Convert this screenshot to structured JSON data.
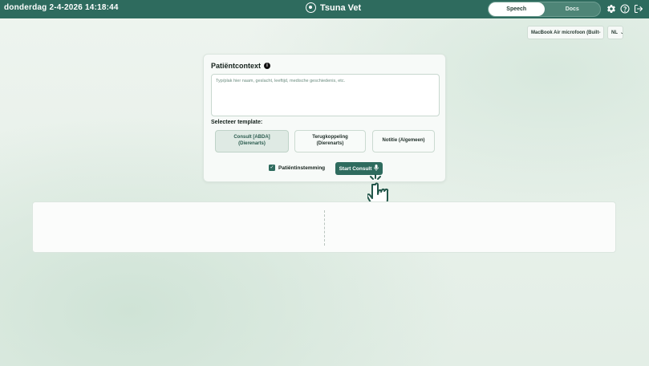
{
  "header": {
    "datetime": "donderdag 2-4-2026 14:18:44",
    "app_title": "Tsuna Vet",
    "mode_tabs": [
      "Speech",
      "Docs"
    ],
    "active_tab": "Speech",
    "icons": [
      "gear-icon",
      "help-icon",
      "logout-icon"
    ],
    "bar_color": "#2e6b5e"
  },
  "devices": {
    "microphone": "MacBook Air microfoon (Built-",
    "language": "NL"
  },
  "patient_context": {
    "title": "Patiëntcontext",
    "placeholder": "Typ/plak hier naam, geslacht, leeftijd, medische geschiedenis, etc.",
    "value": ""
  },
  "templates": {
    "label": "Selecteer template:",
    "options": [
      {
        "line1": "Consult [ABDA]",
        "line2": "(Dierenarts)",
        "selected": true
      },
      {
        "line1": "Terugkoppeling",
        "line2": "(Dierenarts)",
        "selected": false
      },
      {
        "line1": "Notitie (Algemeen)",
        "line2": "",
        "selected": false
      }
    ]
  },
  "consent": {
    "label": "Patiëntinstemming",
    "checked": true
  },
  "start_button": {
    "label": "Start Consult",
    "icon": "microphone-icon"
  }
}
